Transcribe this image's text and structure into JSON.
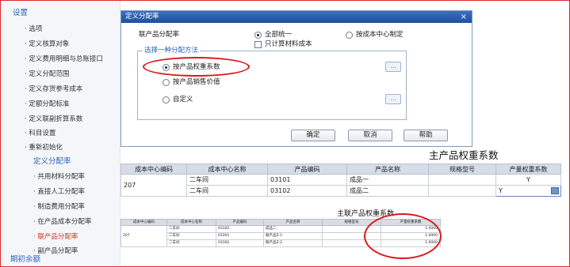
{
  "sidebar": {
    "items": [
      {
        "label": "设置",
        "kind": "head"
      },
      {
        "label": "· 选项",
        "kind": "sub"
      },
      {
        "label": "· 定义核算对象",
        "kind": "sub"
      },
      {
        "label": "· 定义费用明细与总账接口",
        "kind": "sub"
      },
      {
        "label": "· 定义分配范围",
        "kind": "sub"
      },
      {
        "label": "· 定义存货参考成本",
        "kind": "sub"
      },
      {
        "label": "· 定额分配标准",
        "kind": "sub"
      },
      {
        "label": "· 定义联副折算系数",
        "kind": "sub"
      },
      {
        "label": "· 科目设置",
        "kind": "sub"
      },
      {
        "label": "· 重新初始化",
        "kind": "sub"
      },
      {
        "label": "定义分配率",
        "kind": "head"
      },
      {
        "label": "· 共用材料分配率",
        "kind": "sub2"
      },
      {
        "label": "· 直接人工分配率",
        "kind": "sub2"
      },
      {
        "label": "· 制造费用分配率",
        "kind": "sub2"
      },
      {
        "label": "· 在产品成本分配率",
        "kind": "sub2"
      },
      {
        "label": "· 联产品分配率",
        "kind": "active"
      },
      {
        "label": "· 副产品分配率",
        "kind": "sub2"
      },
      {
        "label": "期初余额",
        "kind": "head"
      }
    ]
  },
  "dialog": {
    "title": "定义分配率",
    "close": "×",
    "joint_rate_label": "联产品分配率",
    "opt_all_unified": "全部统一",
    "opt_by_center": "按成本中心制定",
    "chk_material_only": "只计算材料成本",
    "group_legend": "选择一种分配方法",
    "method_weight": "按产品权重系数",
    "method_sales": "按产品销售价值",
    "method_custom": "自定义",
    "ellipsis": "...",
    "btn_ok": "确定",
    "btn_cancel": "取消",
    "btn_help": "帮助"
  },
  "table1": {
    "title": "主产品权重系数",
    "headers": [
      "成本中心编码",
      "成本中心名称",
      "产品编码",
      "产品名称",
      "规格型号",
      "产量权重系数"
    ],
    "center_code": "207",
    "rows": [
      {
        "center_name": "二车间",
        "code": "03101",
        "name": "成品一",
        "spec": "",
        "weight": "Y"
      },
      {
        "center_name": "二车间",
        "code": "03102",
        "name": "成品二",
        "spec": "",
        "weight": "Y"
      }
    ]
  },
  "table2": {
    "title": "主联产品权重系数",
    "headers": [
      "成本中心编码",
      "成本中心名称",
      "产品编码",
      "产品名称",
      "规格型号",
      "产量权重系数"
    ],
    "center_code": "207",
    "rows": [
      {
        "center_name": "二车间",
        "code": "03102",
        "name": "成品二",
        "spec": "",
        "weight": "1.0000"
      },
      {
        "center_name": "二车间",
        "code": "03301",
        "name": "联产品Z-1",
        "spec": "",
        "weight": "1.0000"
      },
      {
        "center_name": "二车间",
        "code": "03302",
        "name": "联产品Z-2",
        "spec": "",
        "weight": "1.0000"
      }
    ]
  },
  "colors": {
    "accent": "#2c63b8",
    "active": "#d2391e",
    "annotation": "#d9181e",
    "title_bar": "#2a5aa8"
  }
}
